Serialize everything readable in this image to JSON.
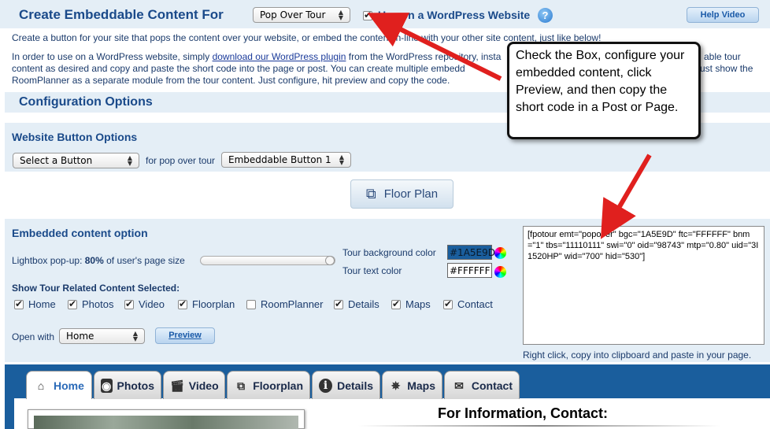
{
  "header": {
    "title": "Create Embeddable Content For",
    "content_select": "Pop Over Tour",
    "wp_label": "Use on a WordPress Website",
    "help_icon": "question-icon",
    "help_video": "Help Video"
  },
  "intro": {
    "line1": "Create a button for your site that pops the content over your website, or embed the content in-line with your other site content, just like below!",
    "p2_a": "In order to use on a WordPress website, simply ",
    "p2_link": "download our WordPress plugin",
    "p2_b": " from the WordPress repository, insta",
    "p2_c": "able tour",
    "line3a": "content as desired and copy and paste the short code into the page or post. You can create multiple embedd",
    "line3b": "ust show the",
    "line4": "RoomPlanner as a separate module from the tour content. Just configure, hit preview and copy the code."
  },
  "config": {
    "title": "Configuration Options"
  },
  "website_button": {
    "title": "Website Button Options",
    "button_select": "Select a Button",
    "for_label": "for pop over tour",
    "style_select": "Embeddable Button 1",
    "floor_plan_button": "Floor Plan"
  },
  "embedded": {
    "title": "Embedded content option",
    "lightbox_label_a": "Lightbox pop-up: ",
    "lightbox_percent": "80%",
    "lightbox_label_b": " of user's page size",
    "lightbox_value": 0.8,
    "bg_color_label": "Tour background color",
    "bg_color_value": "#1A5E9D",
    "text_color_label": "Tour text color",
    "text_color_value": "#FFFFFF",
    "show_related_label": "Show Tour Related Content Selected:",
    "checkboxes": [
      {
        "label": "Home",
        "checked": true
      },
      {
        "label": "Photos",
        "checked": true
      },
      {
        "label": "Video",
        "checked": true
      },
      {
        "label": "Floorplan",
        "checked": true
      },
      {
        "label": "RoomPlanner",
        "checked": false
      },
      {
        "label": "Details",
        "checked": true
      },
      {
        "label": "Maps",
        "checked": true
      },
      {
        "label": "Contact",
        "checked": true
      }
    ],
    "open_with_label": "Open with",
    "open_with_select": "Home",
    "preview_button": "Preview"
  },
  "shortcode": {
    "text": "[fpotour emt=\"popover\" bgc=\"1A5E9D\" ftc=\"FFFFFF\" bnm=\"1\" tbs=\"11110111\" swi=\"0\" oid=\"98743\" mtp=\"0.80\" uid=\"3I1520HP\" wid=\"700\" hid=\"530\"]",
    "hint": "Right click, copy into clipboard and paste in your page."
  },
  "callout": {
    "text": "Check the Box, configure your embedded content, click Preview, and then copy the short code in a Post or Page."
  },
  "preview": {
    "tabs": [
      {
        "label": "Home",
        "icon": "house-icon"
      },
      {
        "label": "Photos",
        "icon": "camera-icon"
      },
      {
        "label": "Video",
        "icon": "film-icon"
      },
      {
        "label": "Floorplan",
        "icon": "floorplan-icon"
      },
      {
        "label": "Details",
        "icon": "info-icon"
      },
      {
        "label": "Maps",
        "icon": "compass-icon"
      },
      {
        "label": "Contact",
        "icon": "envelope-icon"
      }
    ],
    "contact_heading": "For Information, Contact:"
  },
  "colors": {
    "brand_blue": "#1A5E9D",
    "arrow_red": "#E0201E",
    "band_blue": "#E4EEF6"
  }
}
